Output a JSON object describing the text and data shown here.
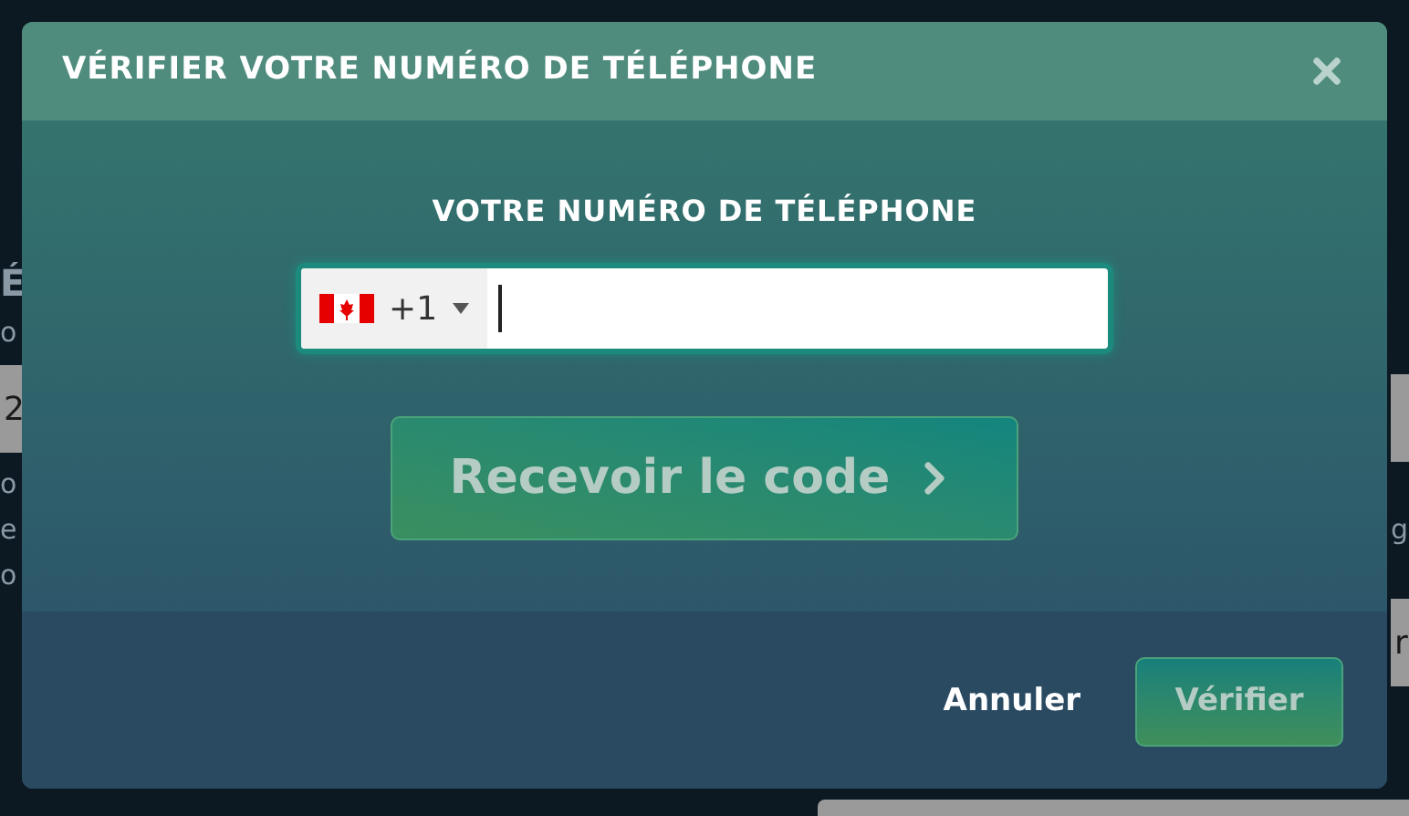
{
  "background_page": {
    "left_texts": [
      {
        "kind": "heading",
        "text": "É"
      },
      {
        "kind": "label",
        "text": "o"
      },
      {
        "kind": "field",
        "text": "2"
      },
      {
        "kind": "label",
        "text": "o"
      },
      {
        "kind": "label",
        "text": "e"
      },
      {
        "kind": "label",
        "text": "o"
      }
    ],
    "right_texts": [
      {
        "kind": "field"
      },
      {
        "kind": "label",
        "text": "g"
      },
      {
        "kind": "field",
        "text": "r"
      }
    ]
  },
  "dialog": {
    "title": "VÉRIFIER VOTRE NUMÉRO DE TÉLÉPHONE",
    "phone_field": {
      "label": "VOTRE NUMÉRO DE TÉLÉPHONE",
      "country_code": "+1",
      "focused": true
    },
    "receive_code_button": {
      "label": "Recevoir le code",
      "disabled": true
    },
    "cancel_button": {
      "label": "Annuler"
    },
    "verify_button": {
      "label": "Vérifier",
      "disabled": true
    }
  }
}
